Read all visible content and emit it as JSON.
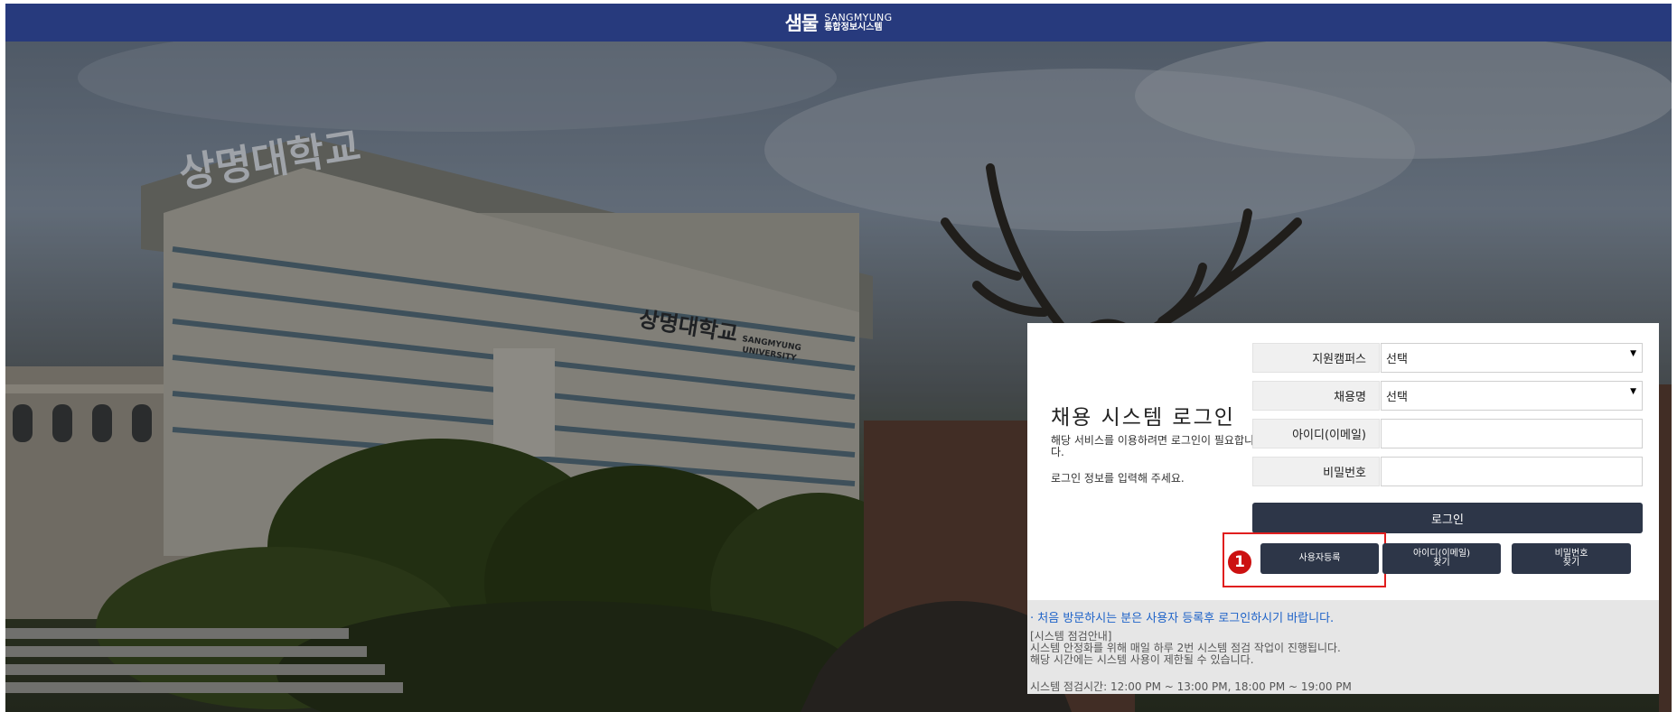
{
  "header": {
    "logo_mark": "샘물",
    "logo_en": "SANGMYUNG",
    "logo_ko": "통합정보시스템"
  },
  "hero": {
    "building_sign": "상명대학교",
    "facade_sign_ko": "상명대학교",
    "facade_sign_en_1": "SANGMYUNG",
    "facade_sign_en_2": "UNIVERSITY"
  },
  "login": {
    "title": "채용 시스템 로그인",
    "desc": "해당 서비스를 이용하려면 로그인이 필요합니다.",
    "desc2": "로그인 정보를 입력해 주세요.",
    "fields": [
      {
        "label": "지원캠퍼스",
        "value": "선택",
        "type": "select"
      },
      {
        "label": "채용명",
        "value": "선택",
        "type": "select"
      },
      {
        "label": "아이디(이메일)",
        "value": "",
        "type": "text"
      },
      {
        "label": "비밀번호",
        "value": "",
        "type": "password"
      }
    ],
    "login_button": "로그인",
    "register_button": "사용자등록",
    "find_id_button_1": "아이디(이메일)",
    "find_id_button_2": "찾기",
    "find_pw_button_1": "비밀번호",
    "find_pw_button_2": "찾기",
    "annotation_number": "1"
  },
  "notice": {
    "first_visit": "· 처음 방문하시는 분은 사용자 등록후 로그인하시기 바랍니다.",
    "maintenance_title": "[시스템 점검안내]",
    "maintenance_line1": "시스템 안정화를 위해 매일 하루 2번 시스템 점검 작업이 진행됩니다.",
    "maintenance_line2": "해당 시간에는 시스템 사용이 제한될 수 있습니다.",
    "schedule": "시스템 점검시간: 12:00 PM ~ 13:00 PM, 18:00 PM ~ 19:00 PM"
  },
  "colors": {
    "header_bg": "#273a7d",
    "button_bg": "#2d3648",
    "notice_link": "#1d62c8",
    "highlight": "#e01e1e"
  }
}
